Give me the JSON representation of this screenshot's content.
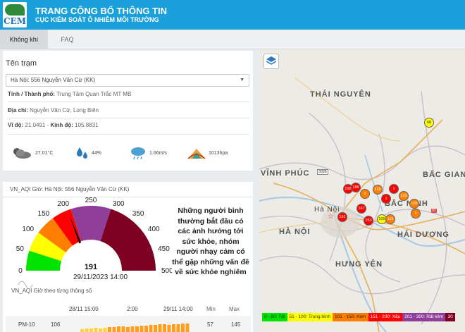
{
  "header": {
    "logo_text": "CEM",
    "title": "TRANG CÔNG BỐ THÔNG TIN",
    "subtitle": "CỤC KIỂM SOÁT Ô NHIỄM MÔI TRƯỜNG"
  },
  "tabs": [
    {
      "label": "Không khí",
      "active": true
    },
    {
      "label": "FAQ",
      "active": false
    }
  ],
  "station": {
    "label": "Tên trạm",
    "selected": "Hà Nội: 556 Nguyễn Văn Cừ (KK)",
    "province_label": "Tỉnh / Thành phố:",
    "province_value": "Trung Tâm Quan Trắc MT MB",
    "address_label": "Địa chỉ:",
    "address_value": "Nguyễn Văn Cừ, Long Biên",
    "lat_label": "Vĩ độ:",
    "lat_value": "21.0491",
    "lon_label": "Kinh độ:",
    "lon_value": "105.8831"
  },
  "weather": {
    "temperature": "27.01°C",
    "humidity": "44%",
    "wind": "1.66m/s",
    "pressure": "1013hpa"
  },
  "aqi": {
    "header": "VN_AQI Giờ: Hà Nội: 556 Nguyễn Văn Cừ (KK)",
    "value": "191",
    "value_num": 191,
    "scale_labels": [
      "0",
      "50",
      "100",
      "150",
      "200",
      "250",
      "300",
      "350",
      "400",
      "450",
      "500"
    ],
    "time": "29/11/2023 14:00",
    "message": "Những người bình thường bắt đầu có các ảnh hưởng tới sức khỏe, nhóm người nhạy cảm có thể gặp những vấn đề về sức khỏe nghiêm",
    "band_colors": [
      "#00e400",
      "#ffff00",
      "#ff7e00",
      "#ff0000",
      "#8f3f97",
      "#7e0023"
    ]
  },
  "history": {
    "title": "VN_AQI Giờ theo từng thông số",
    "time_start": "28/11 15:00",
    "time_mid": "2:00",
    "time_end": "29/11 14:00",
    "min_label": "Min",
    "max_label": "Max",
    "param": "PM-10",
    "param_value": "106",
    "min": "57",
    "max": "145"
  },
  "map": {
    "regions": [
      "THÁI NGUYÊN",
      "VĨNH PHÚC",
      "BẮC GIANG",
      "BẮC NINH",
      "HÀ NỘI",
      "HẢI DƯƠNG",
      "HƯNG YÊN"
    ],
    "capital_label": "Hà Nội",
    "markers": [
      "68",
      "192",
      "188",
      "133",
      "123",
      "105",
      "167",
      "191",
      "153",
      "100",
      "115",
      "1",
      "1",
      "1",
      "1"
    ],
    "road_labels": [
      "305B",
      "37"
    ],
    "legend": [
      {
        "label": "0 - 50: Tốt",
        "color": "#00e400"
      },
      {
        "label": "51 - 100: Trung bình",
        "color": "#ffff00"
      },
      {
        "label": "101 - 150: Kém",
        "color": "#ff7e00"
      },
      {
        "label": "151 - 200: Xấu",
        "color": "#ff0000"
      },
      {
        "label": "201 - 300: Rất kém",
        "color": "#8f3f97"
      },
      {
        "label": "30",
        "color": "#7e0023"
      }
    ]
  }
}
